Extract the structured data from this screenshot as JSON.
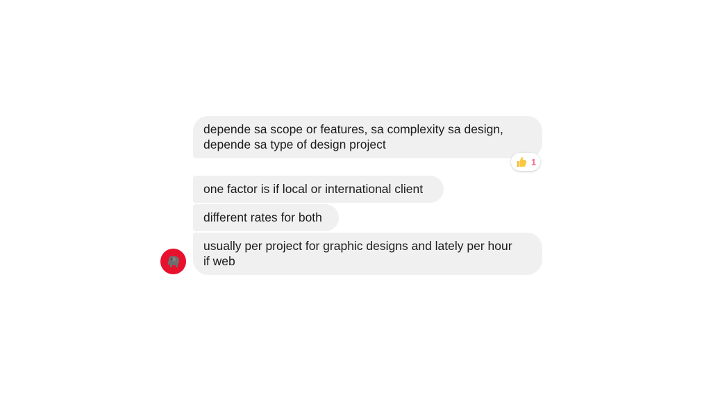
{
  "messages": [
    {
      "lines": [
        "depende sa scope or features, sa complexity sa design,",
        "depende sa type of design project"
      ]
    },
    {
      "lines": [
        "one factor is if local or international client"
      ]
    },
    {
      "lines": [
        "different rates for both"
      ]
    },
    {
      "lines": [
        "usually per project for graphic designs and lately per hour",
        "if web"
      ]
    }
  ],
  "reaction": {
    "icon": "thumbs-up-icon",
    "count": "1",
    "count_color": "#f06b86"
  },
  "avatar": {
    "icon": "elephant-icon",
    "background": "#e8112d"
  },
  "colors": {
    "bubble": "#f0f0f0",
    "text": "#1c1c1c"
  }
}
